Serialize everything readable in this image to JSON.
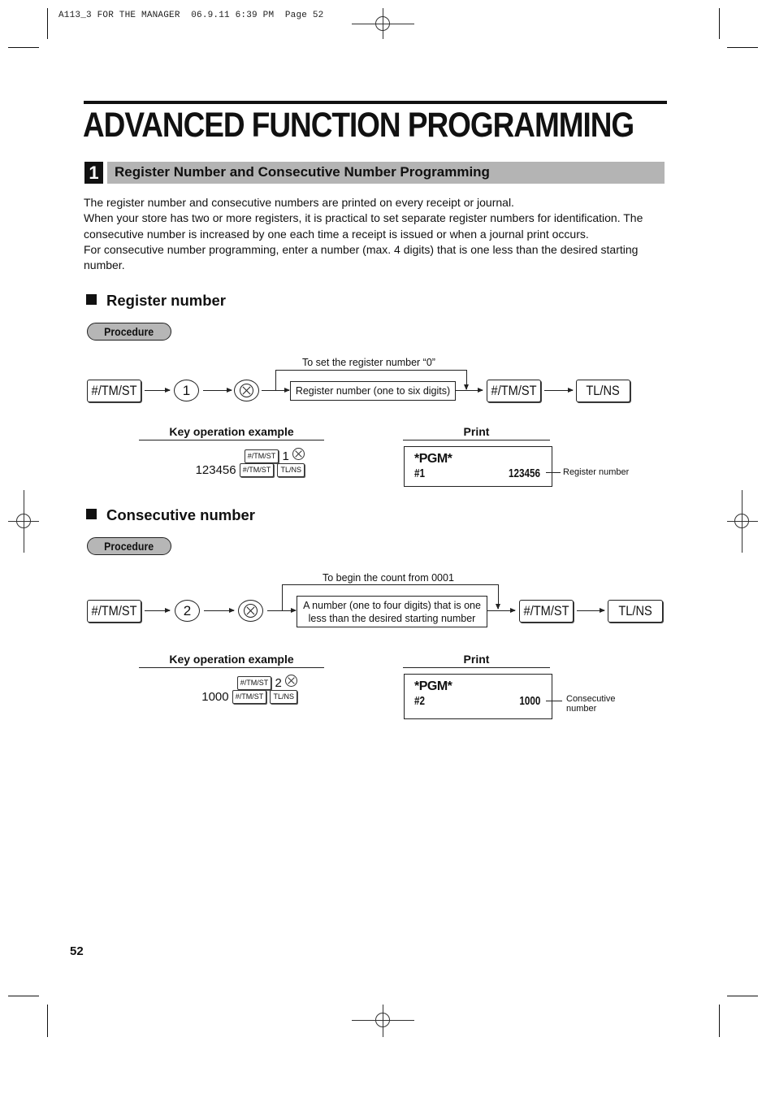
{
  "print_slug": "A113_3 FOR THE MANAGER  06.9.11 6:39 PM  Page 52",
  "page_title": "ADVANCED FUNCTION PROGRAMMING",
  "section": {
    "number": "1",
    "title": "Register Number and Consecutive Number Programming"
  },
  "intro_paragraphs": [
    "The register number and consecutive numbers are printed on every receipt or journal.",
    "When your store has two or more registers, it is practical to set separate register numbers for identification.  The consecutive number is increased by one each time a receipt is issued or when a journal print occurs.",
    "For consecutive number programming, enter a number (max. 4 digits) that is one less than the desired starting number."
  ],
  "register_number": {
    "heading": "Register number",
    "procedure_label": "Procedure",
    "flow": {
      "key_start": "#/TM/ST",
      "number_key": "1",
      "multiply_key": "multiply-key",
      "bypass_label": "To set the register number “0”",
      "entry_box": "Register number (one to six digits)",
      "key_confirm": "#/TM/ST",
      "key_end": "TL/NS"
    },
    "key_operation": {
      "heading": "Key operation example",
      "line1": {
        "key": "#/TM/ST",
        "number": "1"
      },
      "line2": {
        "value": "123456",
        "key1": "#/TM/ST",
        "key2": "TL/NS"
      }
    },
    "print": {
      "heading": "Print",
      "line1": "*PGM*",
      "line2_left": "#1",
      "line2_right": "123456",
      "callout": "Register number"
    }
  },
  "consecutive_number": {
    "heading": "Consecutive number",
    "procedure_label": "Procedure",
    "flow": {
      "key_start": "#/TM/ST",
      "number_key": "2",
      "multiply_key": "multiply-key",
      "bypass_label": "To begin the count from 0001",
      "entry_box_line1": "A number (one to four digits) that is one",
      "entry_box_line2": "less than the desired starting number",
      "key_confirm": "#/TM/ST",
      "key_end": "TL/NS"
    },
    "key_operation": {
      "heading": "Key operation example",
      "line1": {
        "key": "#/TM/ST",
        "number": "2"
      },
      "line2": {
        "value": "1000",
        "key1": "#/TM/ST",
        "key2": "TL/NS"
      }
    },
    "print": {
      "heading": "Print",
      "line1": "*PGM*",
      "line2_left": "#2",
      "line2_right": "1000",
      "callout_line1": "Consecutive",
      "callout_line2": "number"
    }
  },
  "page_number": "52",
  "colors": {
    "section_bar": "#b4b4b4",
    "procedure_pill": "#b6b6b6",
    "ink": "#111111"
  }
}
